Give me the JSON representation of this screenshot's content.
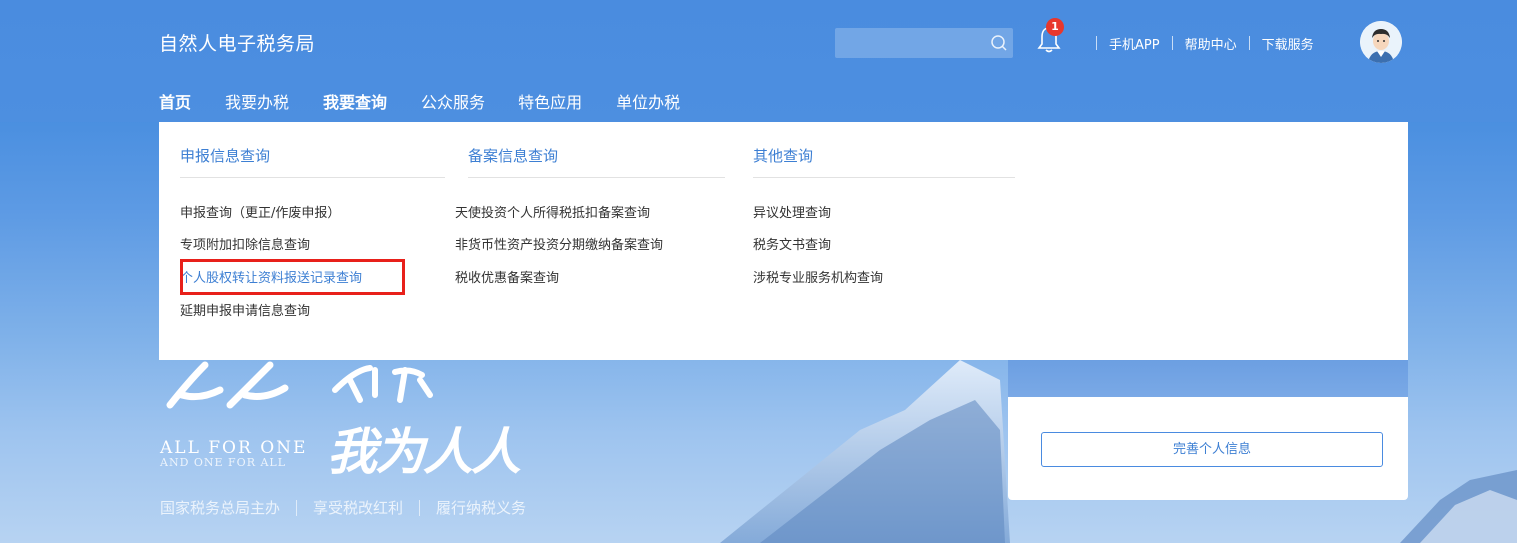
{
  "header": {
    "brand": "自然人电子税务局",
    "search_placeholder": "",
    "notification_count": "1",
    "links": [
      "手机APP",
      "帮助中心",
      "下载服务"
    ]
  },
  "nav": {
    "items": [
      "首页",
      "我要办税",
      "我要查询",
      "公众服务",
      "特色应用",
      "单位办税"
    ]
  },
  "dropdown": {
    "columns": [
      {
        "title": "申报信息查询",
        "items": [
          "申报查询（更正/作废申报）",
          "专项附加扣除信息查询",
          "个人股权转让资料报送记录查询",
          "延期申报申请信息查询"
        ]
      },
      {
        "title": "备案信息查询",
        "items": [
          "天使投资个人所得税抵扣备案查询",
          "非货币性资产投资分期缴纳备案查询",
          "税收优惠备案查询"
        ]
      },
      {
        "title": "其他查询",
        "items": [
          "异议处理查询",
          "税务文书查询",
          "涉税专业服务机构查询"
        ]
      }
    ]
  },
  "hero": {
    "slogan_en_line1": "ALL FOR ONE",
    "slogan_en_line2": "AND ONE FOR ALL",
    "slogan_cn": "我为人人",
    "tagline": [
      "国家税务总局主办",
      "享受税改红利",
      "履行纳税义务"
    ]
  },
  "card": {
    "button_label": "完善个人信息"
  },
  "colors": {
    "brand_blue": "#4a8de0",
    "link_blue": "#3d7fd3",
    "highlight_red": "#e8201a"
  }
}
